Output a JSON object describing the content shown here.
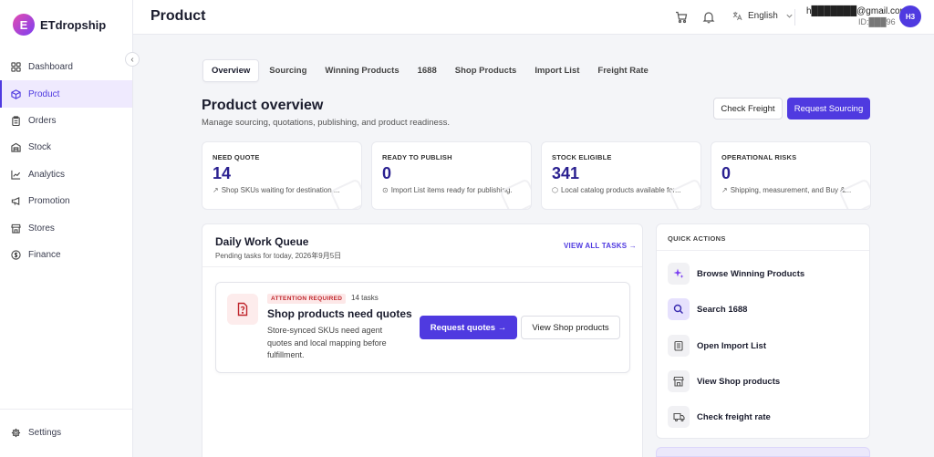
{
  "app": {
    "name": "ETdropship",
    "logo_letter": "E"
  },
  "sidebar": {
    "items": [
      {
        "label": "Dashboard",
        "icon": "dashboard-icon"
      },
      {
        "label": "Product",
        "icon": "box-icon",
        "active": true
      },
      {
        "label": "Orders",
        "icon": "clipboard-icon"
      },
      {
        "label": "Stock",
        "icon": "warehouse-icon"
      },
      {
        "label": "Analytics",
        "icon": "chart-icon"
      },
      {
        "label": "Promotion",
        "icon": "megaphone-icon"
      },
      {
        "label": "Stores",
        "icon": "store-icon"
      },
      {
        "label": "Finance",
        "icon": "dollar-icon"
      }
    ],
    "settings_label": "Settings",
    "collapse_glyph": "‹"
  },
  "header": {
    "title": "Product",
    "language": "English",
    "user_email": "h███████@gmail.com",
    "user_id": "ID:███96",
    "avatar_initials": "H3"
  },
  "tabs": [
    "Overview",
    "Sourcing",
    "Winning Products",
    "1688",
    "Shop Products",
    "Import List",
    "Freight Rate"
  ],
  "overview": {
    "title": "Product overview",
    "subtitle": "Manage sourcing, quotations, publishing, and product readiness.",
    "check_freight": "Check Freight",
    "request_sourcing": "Request Sourcing"
  },
  "stats": [
    {
      "label": "NEED QUOTE",
      "value": "14",
      "desc": "Shop SKUs waiting for destination ...",
      "desc_icon": "trend-icon"
    },
    {
      "label": "READY TO PUBLISH",
      "value": "0",
      "desc": "Import List items ready for publishing.",
      "desc_icon": "check-circle-icon"
    },
    {
      "label": "STOCK ELIGIBLE",
      "value": "341",
      "desc": "Local catalog products available for...",
      "desc_icon": "cube-icon"
    },
    {
      "label": "OPERATIONAL RISKS",
      "value": "0",
      "desc": "Shipping, measurement, and Buy &...",
      "desc_icon": "trend-icon"
    }
  ],
  "queue": {
    "title": "Daily Work Queue",
    "subtitle": "Pending tasks for today, 2026年9月5日",
    "view_all": "VIEW ALL TASKS →",
    "task": {
      "badge": "ATTENTION REQUIRED",
      "count": "14 tasks",
      "title": "Shop products need quotes",
      "desc": "Store-synced SKUs need agent quotes and local mapping before fulfillment.",
      "primary": "Request quotes →",
      "secondary": "View Shop products"
    }
  },
  "quick_actions": {
    "title": "QUICK ACTIONS",
    "items": [
      {
        "label": "Browse Winning Products",
        "icon": "sparkle-icon"
      },
      {
        "label": "Search 1688",
        "icon": "search-icon"
      },
      {
        "label": "Open Import List",
        "icon": "list-icon"
      },
      {
        "label": "View Shop products",
        "icon": "store-icon"
      },
      {
        "label": "Check freight rate",
        "icon": "truck-icon"
      }
    ]
  },
  "colors": {
    "accent": "#4f3ae0",
    "danger": "#c0272d"
  }
}
